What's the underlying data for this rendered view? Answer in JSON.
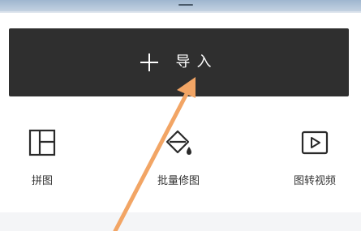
{
  "import_button": {
    "label": "导入",
    "icon": "plus-icon"
  },
  "tools": [
    {
      "label": "拼图",
      "icon": "collage-icon"
    },
    {
      "label": "批量修图",
      "icon": "paint-bucket-icon"
    },
    {
      "label": "图转视频",
      "icon": "play-video-icon"
    }
  ],
  "colors": {
    "button_bg": "#2f2f2f",
    "arrow": "#f2a565",
    "label_text": "#333333"
  }
}
